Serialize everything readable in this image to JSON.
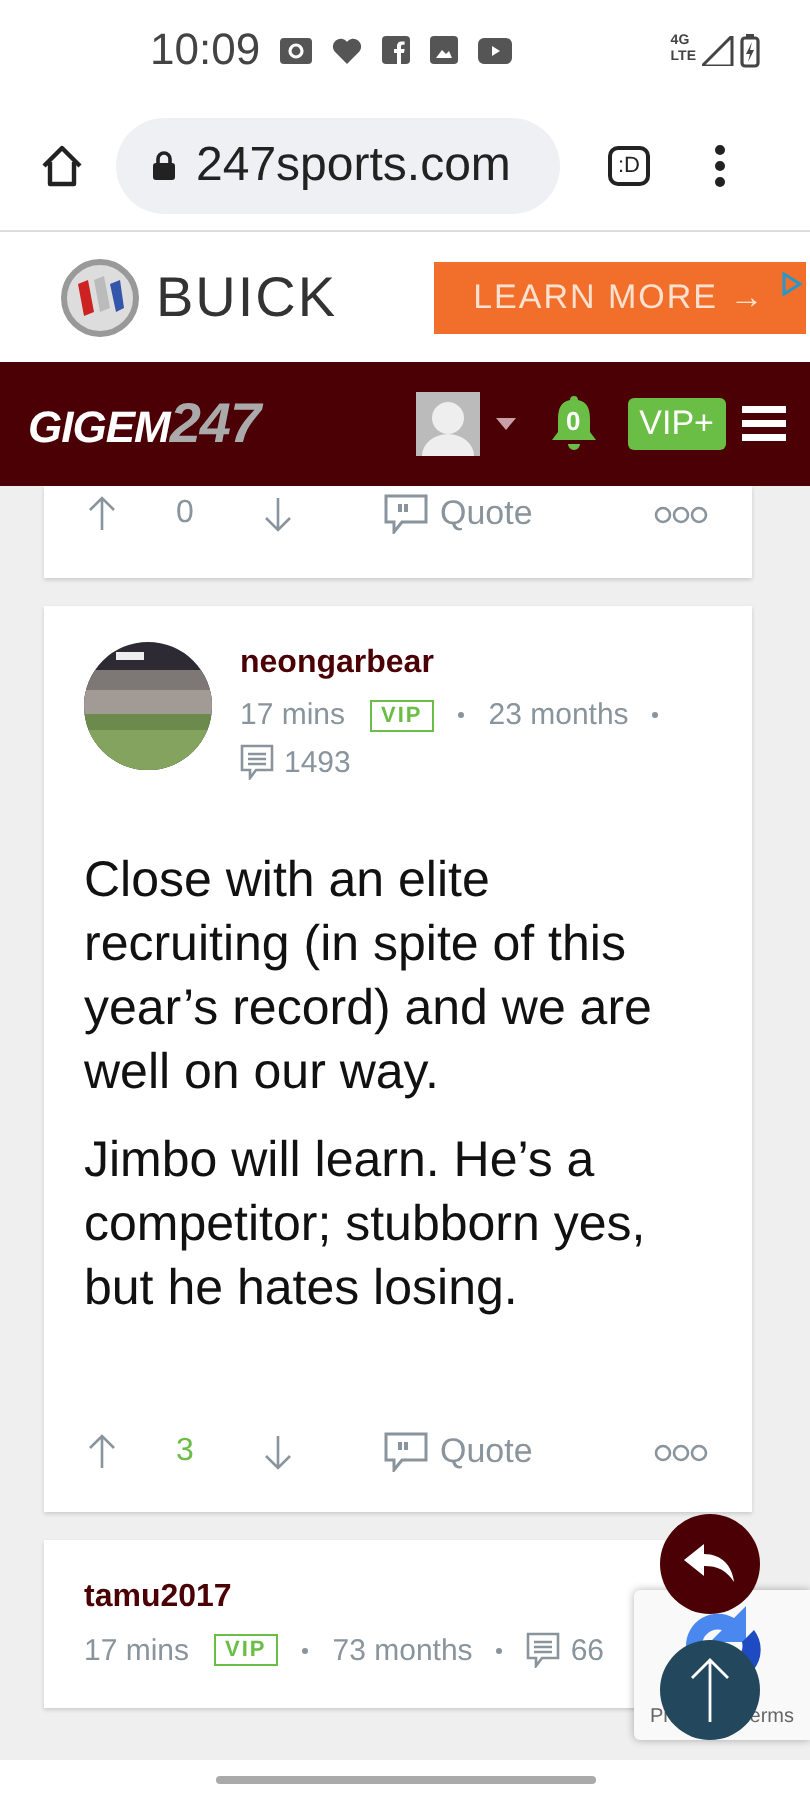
{
  "status_bar": {
    "time": "10:09",
    "network_top": "4G",
    "network_bottom": "LTE"
  },
  "browser": {
    "url": "247sports.com",
    "tab_label": ":D"
  },
  "ad": {
    "brand": "BUICK",
    "cta": "LEARN MORE →"
  },
  "header": {
    "logo_word": "GIGEM",
    "logo_number": "247",
    "notifications": "0",
    "vip_button": "VIP+"
  },
  "posts": [
    {
      "kind": "tail",
      "actions": {
        "score": "0",
        "positive": false,
        "quote": "Quote"
      }
    },
    {
      "kind": "full",
      "author": "neongarbear",
      "avatar": {
        "kind": "picture"
      },
      "time": "17 mins",
      "badge": "VIP",
      "tenure": "23 months",
      "comments": "1493",
      "paragraphs": [
        "Close with an elite recruiting (in spite of this year’s record) and we are well on our way.",
        "Jimbo will learn. He’s a competitor; stubborn yes, but he hates losing."
      ],
      "actions": {
        "score": "3",
        "positive": true,
        "quote": "Quote"
      }
    },
    {
      "kind": "head",
      "author": "tamu2017",
      "time": "17 mins",
      "badge": "VIP",
      "tenure": "73 months",
      "comments": "66"
    }
  ],
  "recaptcha": {
    "left_text": "Pr",
    "right_text": "erms"
  }
}
